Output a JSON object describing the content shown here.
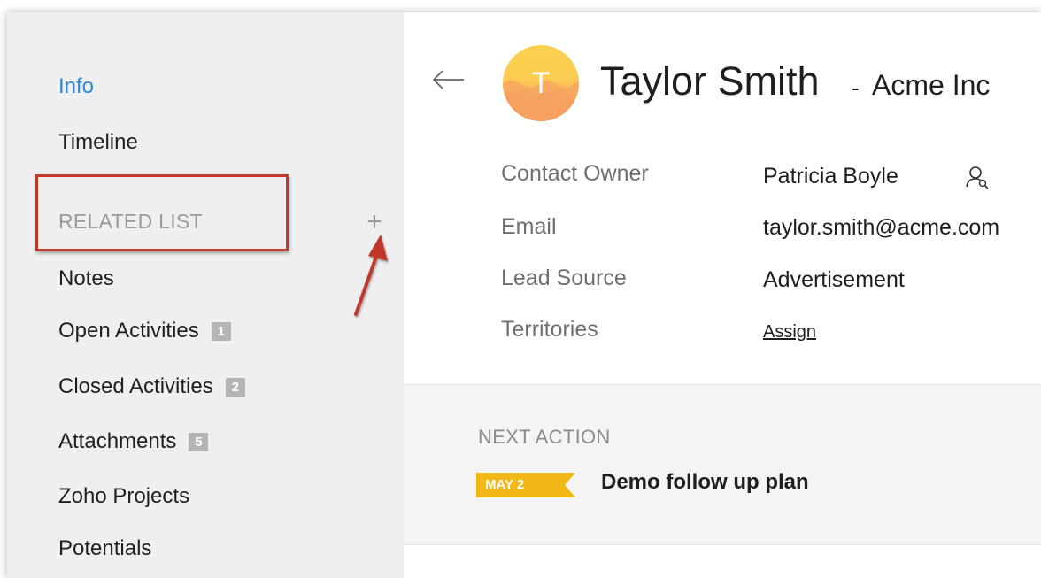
{
  "sidebar": {
    "info": "Info",
    "timeline": "Timeline",
    "related_list_label": "RELATED LIST",
    "add_symbol": "+",
    "items": [
      {
        "label": "Notes",
        "count": ""
      },
      {
        "label": "Open Activities",
        "count": "1"
      },
      {
        "label": "Closed Activities",
        "count": "2"
      },
      {
        "label": "Attachments",
        "count": "5"
      },
      {
        "label": "Zoho Projects",
        "count": ""
      },
      {
        "label": "Potentials",
        "count": ""
      }
    ]
  },
  "header": {
    "back_icon": "back-arrow-icon",
    "avatar_letter": "T",
    "name": "Taylor Smith",
    "separator": "-",
    "company": "Acme Inc"
  },
  "fields": {
    "owner": {
      "label": "Contact Owner",
      "value": "Patricia Boyle"
    },
    "email": {
      "label": "Email",
      "value": "taylor.smith@acme.com"
    },
    "lead_source": {
      "label": "Lead Source",
      "value": "Advertisement"
    },
    "territories": {
      "label": "Territories",
      "value": "Assign"
    }
  },
  "next_action": {
    "label": "NEXT ACTION",
    "date": "MAY 2",
    "title": "Demo follow up plan"
  },
  "colors": {
    "accent": "#2f86d6",
    "highlight": "#c0392b",
    "date_tag": "#f2b817"
  }
}
